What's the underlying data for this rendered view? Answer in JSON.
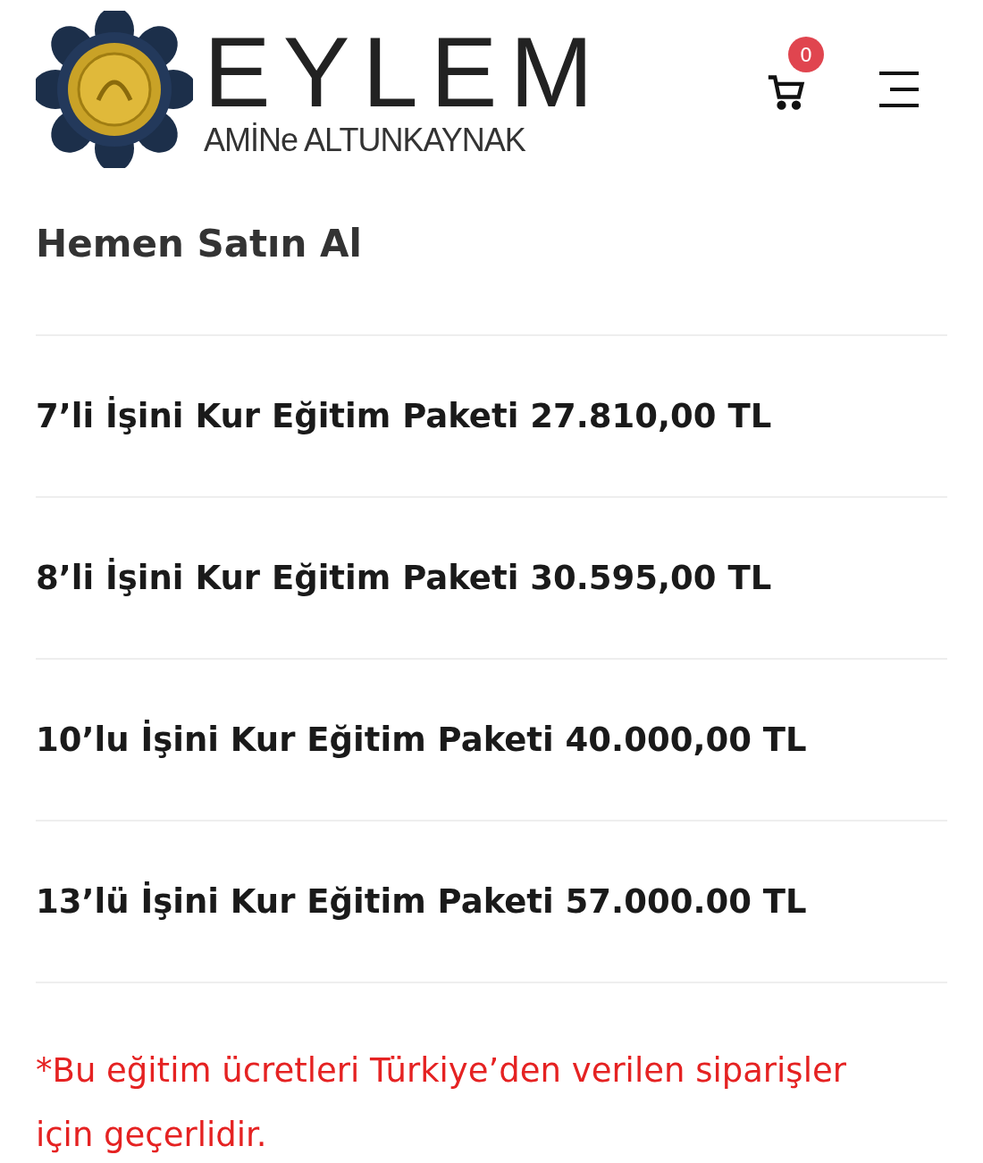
{
  "header": {
    "logo_title": "EYLEM",
    "logo_subtitle": "AMİNe ALTUNKAYNAK",
    "cart_count": "0"
  },
  "section_title": "Hemen Satın Al",
  "packages": [
    {
      "label": "7’li İşini Kur Eğitim Paketi 27.810,00 TL"
    },
    {
      "label": "8’li İşini Kur Eğitim Paketi 30.595,00 TL"
    },
    {
      "label": "10’lu İşini Kur Eğitim Paketi 40.000,00 TL"
    },
    {
      "label": "13’lü İşini Kur Eğitim Paketi 57.000.00 TL"
    }
  ],
  "note": "*Bu eğitim ücretleri Türkiye’den verilen siparişler için geçerlidir."
}
